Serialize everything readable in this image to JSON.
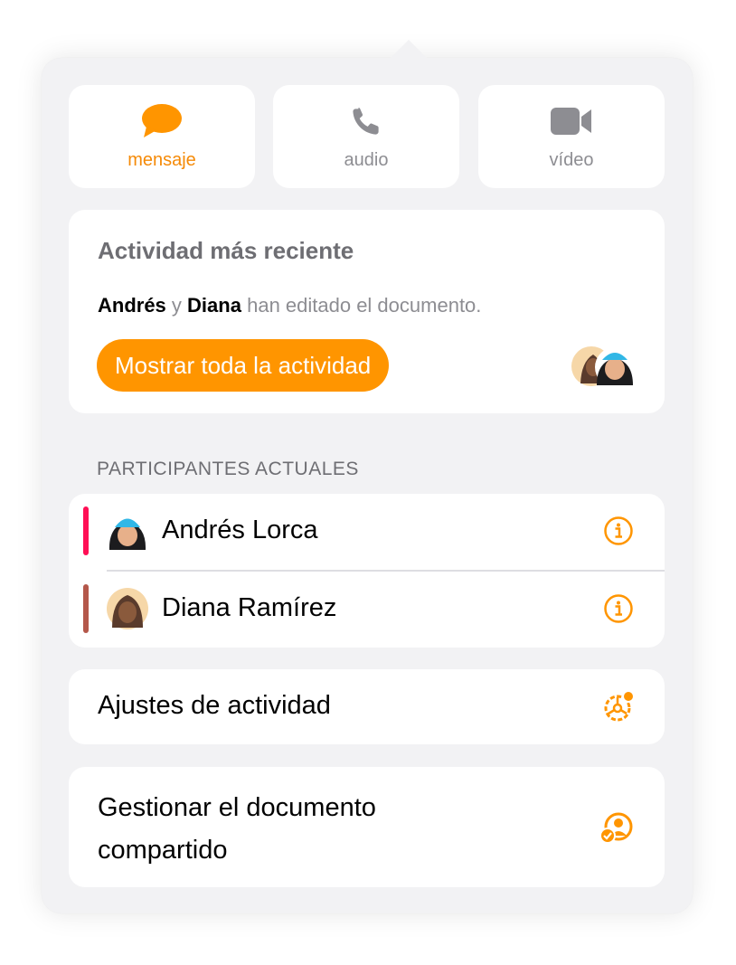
{
  "actions": {
    "message": {
      "label": "mensaje",
      "icon": "message-bubble-icon"
    },
    "audio": {
      "label": "audio",
      "icon": "phone-icon"
    },
    "video": {
      "label": "vídeo",
      "icon": "video-camera-icon"
    }
  },
  "activity": {
    "title": "Actividad más reciente",
    "user1": "Andrés",
    "conjunction": "y",
    "user2": "Diana",
    "text_suffix": "han editado el documento.",
    "button_label": "Mostrar toda la actividad"
  },
  "participants": {
    "header": "PARTICIPANTES ACTUALES",
    "items": [
      {
        "name": "Andrés Lorca",
        "color": "#ff0f55",
        "info_icon": "info-icon"
      },
      {
        "name": "Diana Ramírez",
        "color": "#b4574a",
        "info_icon": "info-icon"
      }
    ]
  },
  "settings": {
    "label": "Ajustes de actividad",
    "icon": "activity-settings-icon"
  },
  "manage": {
    "label": "Gestionar el documento compartido",
    "icon": "shared-person-icon"
  },
  "colors": {
    "accent": "#ff9500",
    "accent_text": "#f58a07",
    "background": "#f2f2f4"
  }
}
